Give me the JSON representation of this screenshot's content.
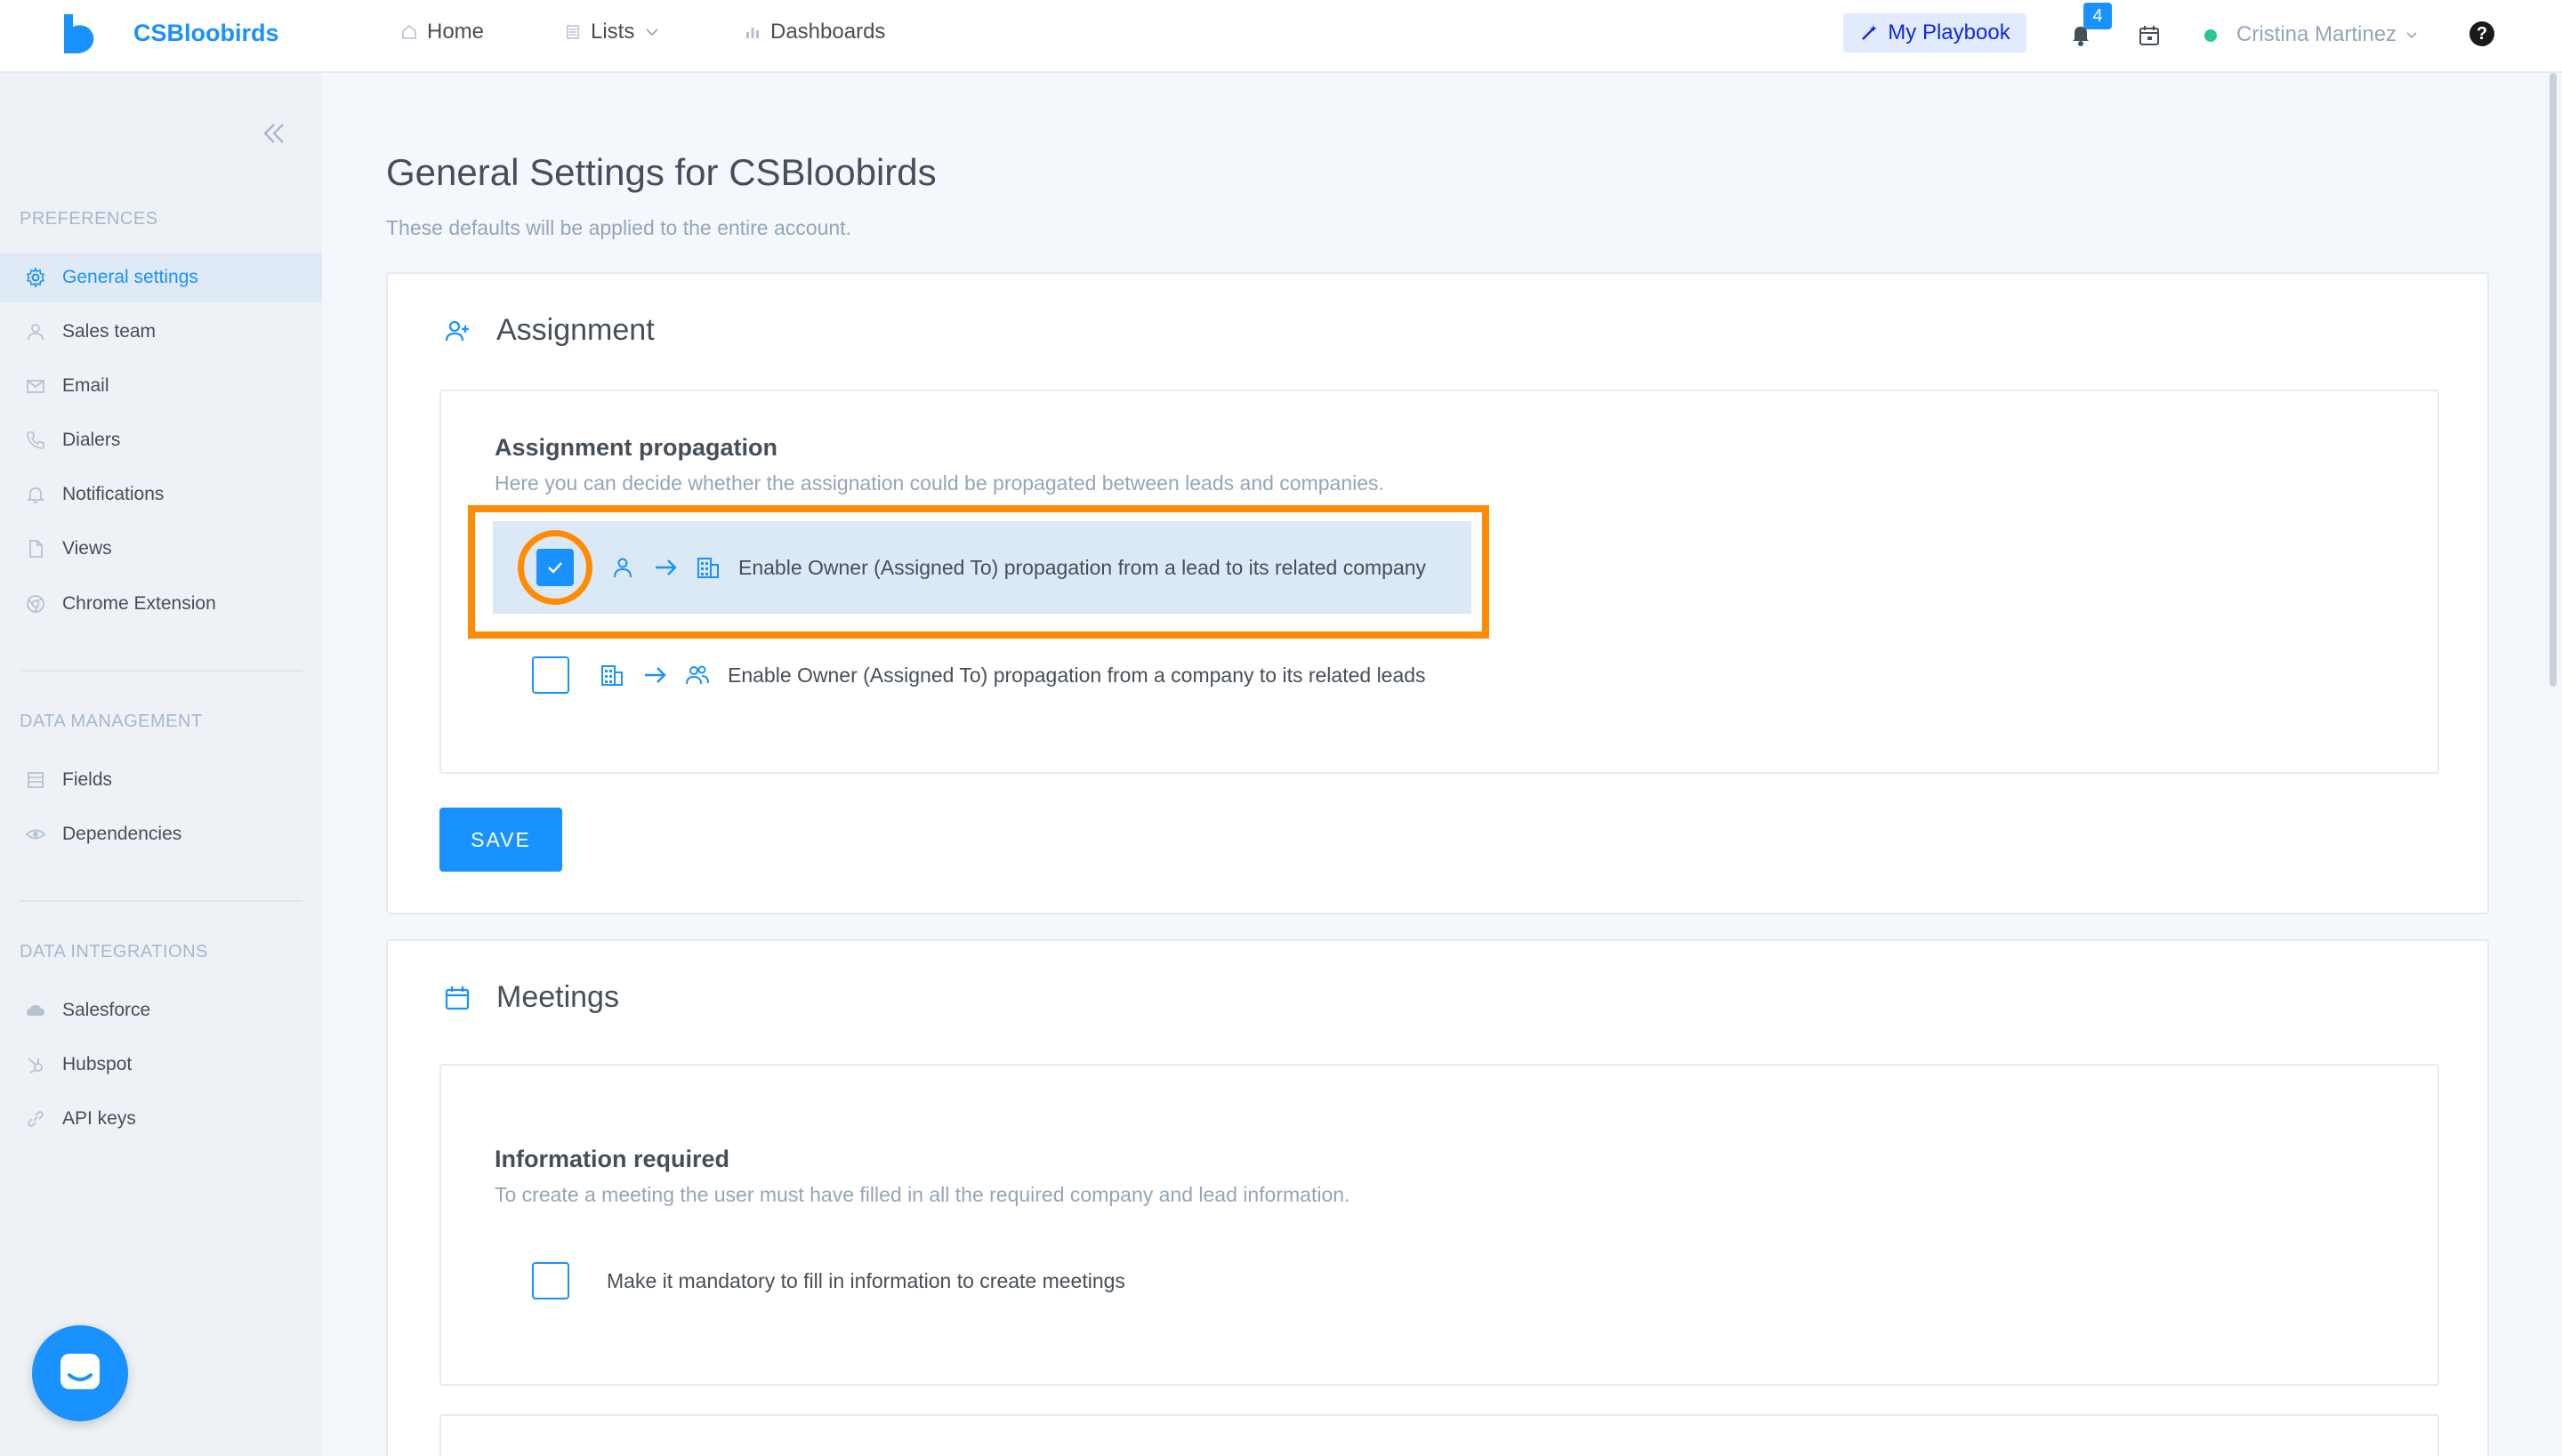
{
  "header": {
    "brand": "CSBloobirds",
    "nav": [
      {
        "label": "Home",
        "icon": "home-icon"
      },
      {
        "label": "Lists",
        "icon": "list-icon"
      },
      {
        "label": "Dashboards",
        "icon": "bar-chart-icon"
      }
    ],
    "playbook_label": "My Playbook",
    "notification_count": "4",
    "user_name": "Cristina Martinez",
    "help_label": "?"
  },
  "sidebar": {
    "sections": [
      {
        "title": "PREFERENCES",
        "items": [
          {
            "label": "General settings",
            "icon": "gear-icon",
            "active": true
          },
          {
            "label": "Sales team",
            "icon": "person-icon"
          },
          {
            "label": "Email",
            "icon": "mail-icon"
          },
          {
            "label": "Dialers",
            "icon": "phone-icon"
          },
          {
            "label": "Notifications",
            "icon": "bell-icon"
          },
          {
            "label": "Views",
            "icon": "document-icon"
          },
          {
            "label": "Chrome Extension",
            "icon": "chrome-icon"
          }
        ]
      },
      {
        "title": "DATA MANAGEMENT",
        "items": [
          {
            "label": "Fields",
            "icon": "fields-icon"
          },
          {
            "label": "Dependencies",
            "icon": "eye-icon"
          }
        ]
      },
      {
        "title": "DATA INTEGRATIONS",
        "items": [
          {
            "label": "Salesforce",
            "icon": "cloud-icon"
          },
          {
            "label": "Hubspot",
            "icon": "hubspot-icon"
          },
          {
            "label": "API keys",
            "icon": "link-icon"
          }
        ]
      }
    ]
  },
  "main": {
    "title": "General Settings for CSBloobirds",
    "subtitle": "These defaults will be applied to the entire account.",
    "assignment": {
      "heading": "Assignment",
      "box_title": "Assignment propagation",
      "box_sub": "Here you can decide whether the assignation could be propagated between leads and companies.",
      "options": [
        {
          "label": "Enable Owner (Assigned To) propagation from a lead to its related company",
          "checked": true
        },
        {
          "label": "Enable Owner (Assigned To) propagation from a company to its related leads",
          "checked": false
        }
      ],
      "save_label": "SAVE"
    },
    "meetings": {
      "heading": "Meetings",
      "box_title": "Information required",
      "box_sub": "To create a meeting the user must have filled in all the required company and lead information.",
      "options": [
        {
          "label": "Make it mandatory to fill in information to create meetings",
          "checked": false
        }
      ]
    }
  },
  "colors": {
    "accent": "#1991ff",
    "highlight": "#ff8c00"
  }
}
